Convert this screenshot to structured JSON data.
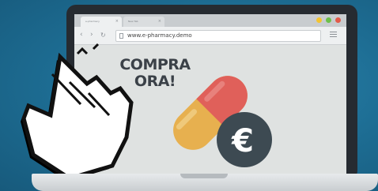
{
  "browser": {
    "tabs": [
      {
        "label": "e-pharmacy"
      },
      {
        "label": "New Tab"
      }
    ],
    "url": "www.e-pharmacy.demo",
    "window_buttons": {
      "colors": [
        "#f4c430",
        "#6cc04a",
        "#e25a4a"
      ]
    }
  },
  "page": {
    "headline_line1": "COMPRA",
    "headline_line2": "ORA!",
    "currency_symbol": "€"
  },
  "colors": {
    "background": "#1f6f95",
    "pill_top": "#e0605a",
    "pill_bottom": "#e7b04f",
    "coin": "#3d4a52",
    "text": "#3b4148"
  }
}
